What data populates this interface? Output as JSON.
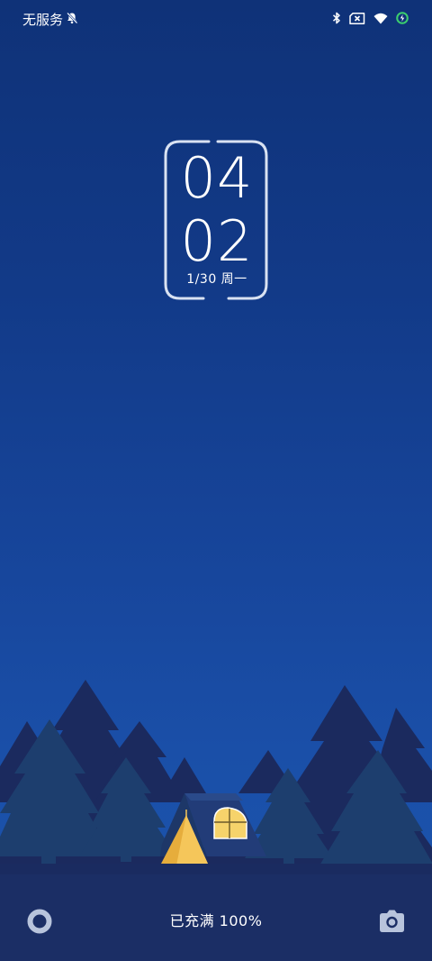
{
  "status_bar": {
    "carrier": "无服务",
    "icons": [
      "mute-bell-icon",
      "bluetooth-icon",
      "sim-absent-icon",
      "wifi-icon",
      "battery-charging-icon"
    ]
  },
  "clock": {
    "hours": "04",
    "minutes": "02",
    "date": "1/30 周一"
  },
  "bottom_bar": {
    "charge_status": "已充满 100%",
    "left_icon": "assistant-circle-icon",
    "right_icon": "camera-icon"
  },
  "colors": {
    "sky_top": "#0f3278",
    "sky_bottom": "#1c55ae",
    "tree_dark": "#1b2a5e",
    "tree_teal": "#1d3e6e",
    "tent_light": "#f5c65a",
    "battery_accent": "#3ccf6e"
  }
}
